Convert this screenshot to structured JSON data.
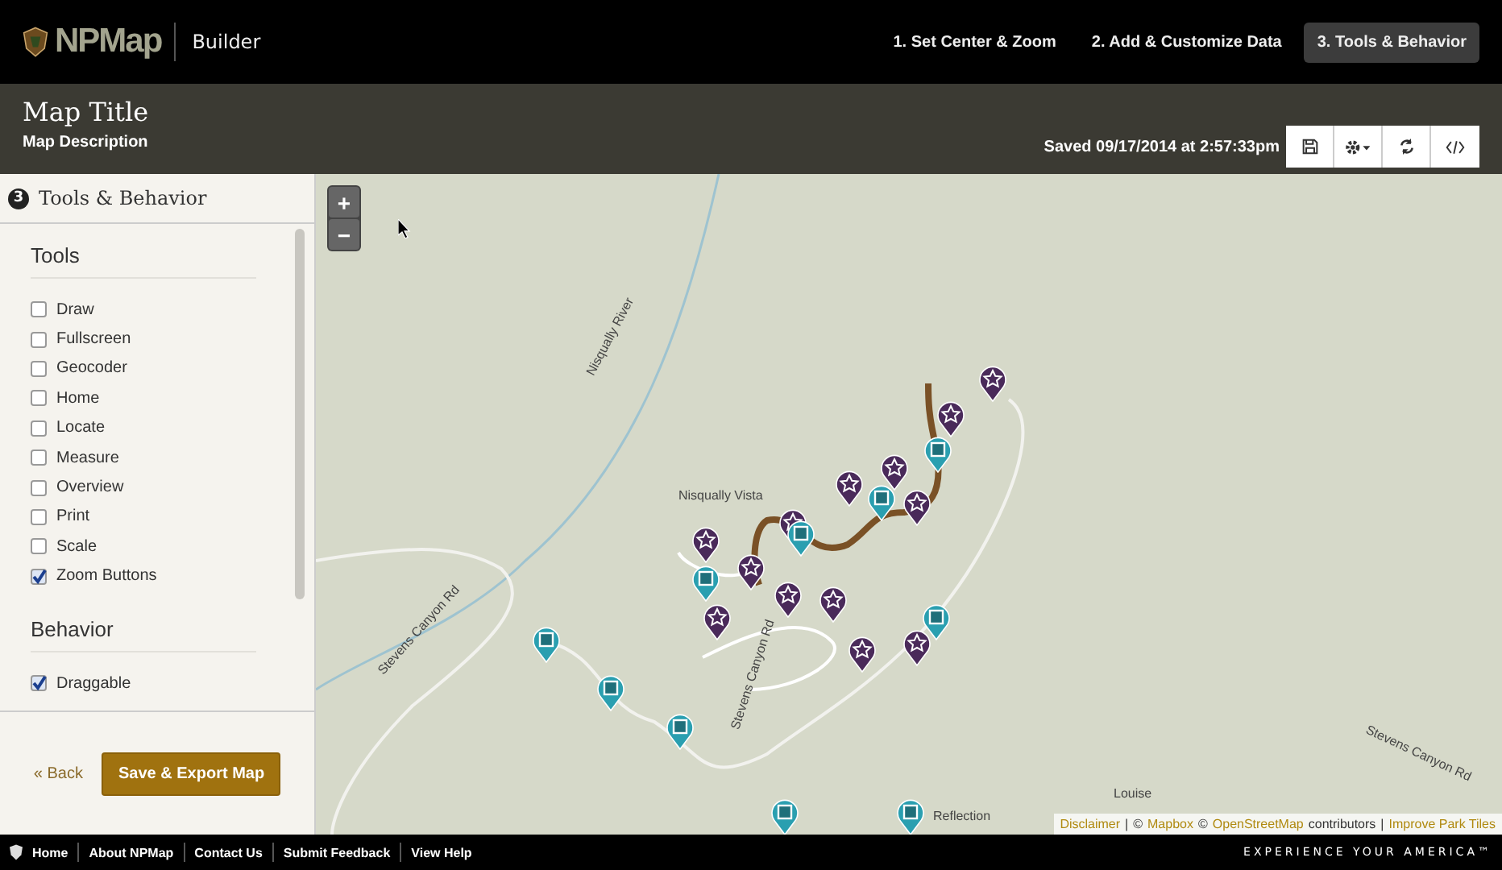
{
  "header": {
    "logo": "NPMap",
    "app_name": "Builder",
    "steps": [
      {
        "label": "1. Set Center & Zoom",
        "selected": false
      },
      {
        "label": "2. Add & Customize Data",
        "selected": false
      },
      {
        "label": "3. Tools & Behavior",
        "selected": true
      }
    ]
  },
  "title_bar": {
    "title": "Map Title",
    "description": "Map Description",
    "saved": "Saved 09/17/2014 at 2:57:33pm"
  },
  "sidebar": {
    "step_number": "3",
    "heading": "Tools & Behavior",
    "sections": [
      {
        "title": "Tools",
        "options": [
          {
            "label": "Draw",
            "checked": false
          },
          {
            "label": "Fullscreen",
            "checked": false
          },
          {
            "label": "Geocoder",
            "checked": false
          },
          {
            "label": "Home",
            "checked": false
          },
          {
            "label": "Locate",
            "checked": false
          },
          {
            "label": "Measure",
            "checked": false
          },
          {
            "label": "Overview",
            "checked": false
          },
          {
            "label": "Print",
            "checked": false
          },
          {
            "label": "Scale",
            "checked": false
          },
          {
            "label": "Zoom Buttons",
            "checked": true
          }
        ]
      },
      {
        "title": "Behavior",
        "options": [
          {
            "label": "Draggable",
            "checked": true
          }
        ]
      }
    ],
    "back": "« Back",
    "save": "Save & Export Map"
  },
  "map": {
    "zoom_in": "+",
    "zoom_out": "−",
    "labels": [
      "Nisqually Vista",
      "Nisqually River",
      "Stevens Canyon Rd",
      "Stevens Canyon Rd",
      "Stevens Canyon Rd",
      "Reflection",
      "Louise"
    ],
    "attribution": [
      {
        "kind": "link",
        "text": "Disclaimer"
      },
      {
        "kind": "text",
        "text": "|"
      },
      {
        "kind": "text",
        "text": "©"
      },
      {
        "kind": "link",
        "text": "Mapbox"
      },
      {
        "kind": "text",
        "text": "©"
      },
      {
        "kind": "link",
        "text": "OpenStreetMap"
      },
      {
        "kind": "text",
        "text": "contributors"
      },
      {
        "kind": "text",
        "text": "|"
      },
      {
        "kind": "link",
        "text": "Improve Park Tiles"
      }
    ]
  },
  "footer": {
    "links": [
      "Home",
      "About NPMap",
      "Contact Us",
      "Submit Feedback",
      "View Help"
    ],
    "tagline": "EXPERIENCE YOUR AMERICA™"
  }
}
